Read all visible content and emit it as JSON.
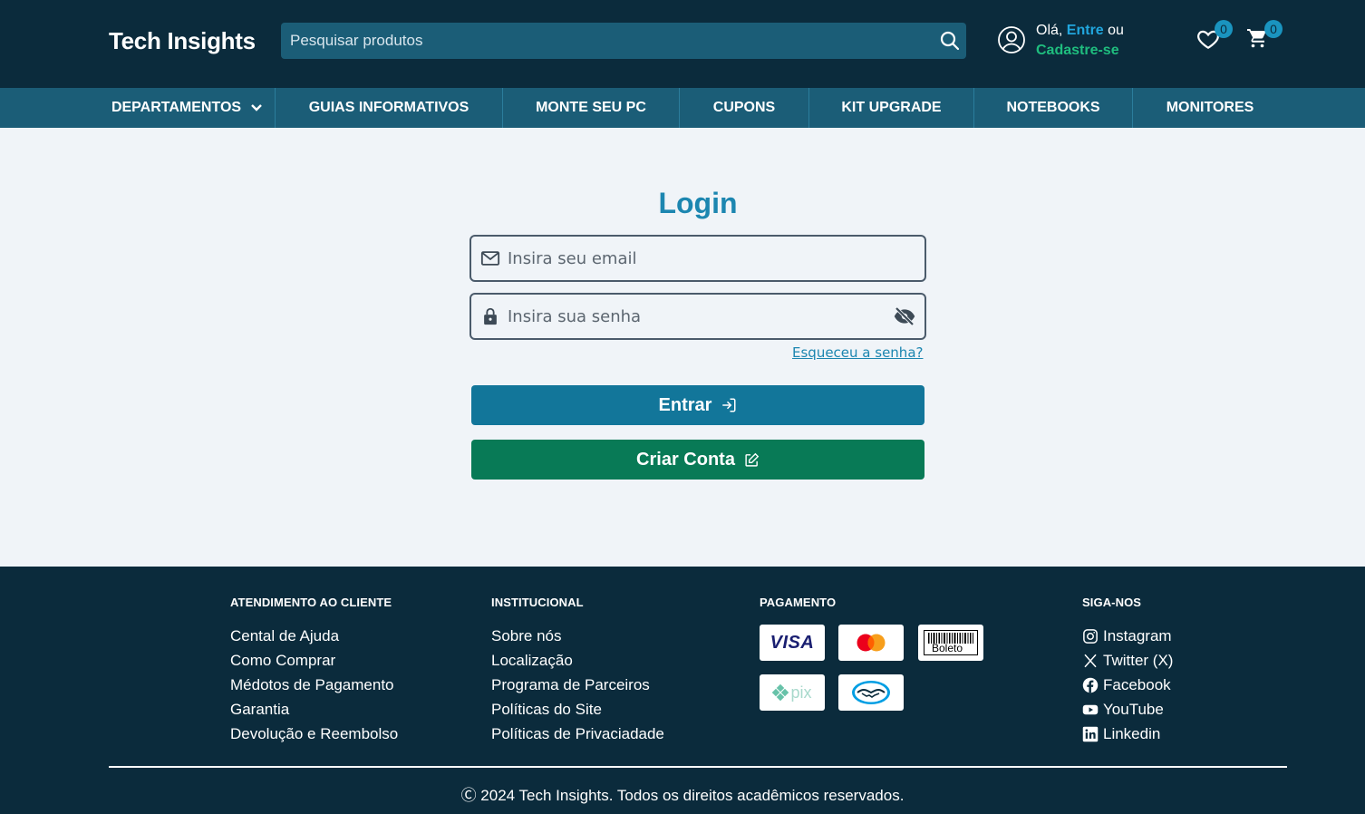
{
  "header": {
    "logo": "Tech Insights",
    "search_placeholder": "Pesquisar produtos",
    "greeting_prefix": "Olá,",
    "login_link": "Entre",
    "greeting_suffix": "ou",
    "signup_link": "Cadastre-se",
    "wishlist_count": "0",
    "cart_count": "0"
  },
  "nav": {
    "items": [
      {
        "label": "DEPARTAMENTOS"
      },
      {
        "label": "GUIAS INFORMATIVOS"
      },
      {
        "label": "MONTE SEU PC"
      },
      {
        "label": "CUPONS"
      },
      {
        "label": "KIT UPGRADE"
      },
      {
        "label": "NOTEBOOKS"
      },
      {
        "label": "MONITORES"
      }
    ]
  },
  "login": {
    "title": "Login",
    "email_placeholder": "Insira seu email",
    "password_placeholder": "Insira sua senha",
    "forgot_password": "Esqueceu a senha?",
    "login_button": "Entrar",
    "create_account_button": "Criar Conta"
  },
  "footer": {
    "customer_service": {
      "title": "ATENDIMENTO AO CLIENTE",
      "links": [
        "Cental de Ajuda",
        "Como Comprar",
        "Médotos de Pagamento",
        "Garantia",
        "Devolução e Reembolso"
      ]
    },
    "institutional": {
      "title": "INSTITUCIONAL",
      "links": [
        "Sobre nós",
        "Localização",
        "Programa de Parceiros",
        "Políticas do Site",
        "Políticas de Privaciadade"
      ]
    },
    "payment": {
      "title": "PAGAMENTO",
      "methods": [
        {
          "name": "VISA",
          "icon": "visa-icon"
        },
        {
          "name": "Mastercard",
          "icon": "mastercard-icon"
        },
        {
          "name": "Boleto",
          "icon": "boleto-icon"
        },
        {
          "name": "pix",
          "icon": "pix-icon"
        },
        {
          "name": "Mercado Pago",
          "icon": "mercadopago-icon"
        }
      ]
    },
    "social": {
      "title": "SIGA-NOS",
      "links": [
        {
          "label": "Instagram",
          "icon": "instagram-icon"
        },
        {
          "label": "Twitter (X)",
          "icon": "x-twitter-icon"
        },
        {
          "label": "Facebook",
          "icon": "facebook-icon"
        },
        {
          "label": "YouTube",
          "icon": "youtube-icon"
        },
        {
          "label": "Linkedin",
          "icon": "linkedin-icon"
        }
      ]
    },
    "copyright_symbol": "Ⓒ",
    "copyright": "2024 Tech Insights. Todos os direitos acadêmicos reservados."
  },
  "colors": {
    "header_bg": "#0b2b3c",
    "nav_bg": "#1b5d77",
    "accent_blue": "#1c86b0",
    "login_button": "#12769a",
    "create_button": "#087a56",
    "signup_green": "#1fbd7e",
    "page_bg": "#f0f4f8"
  }
}
